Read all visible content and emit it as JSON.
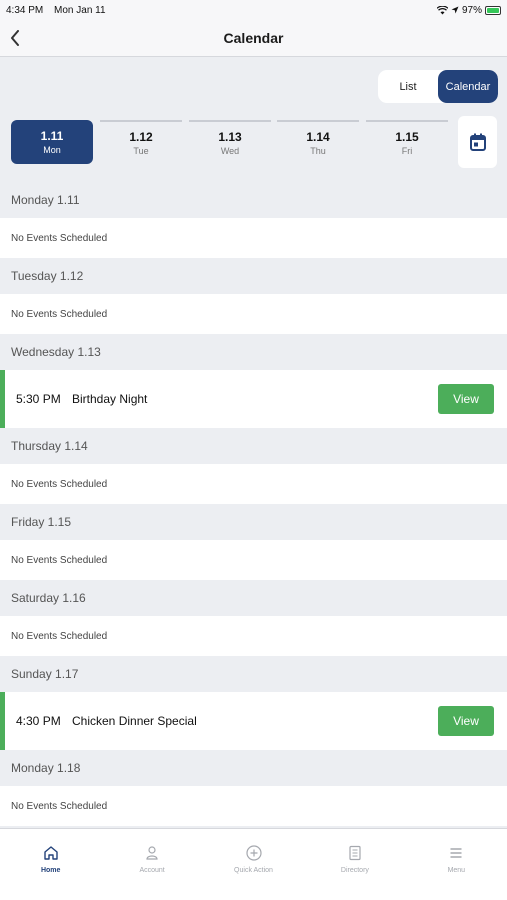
{
  "status_bar": {
    "time": "4:34 PM",
    "date": "Mon Jan 11",
    "battery": "97%"
  },
  "nav": {
    "title": "Calendar"
  },
  "view_toggle": {
    "list_label": "List",
    "calendar_label": "Calendar",
    "selected": "Calendar"
  },
  "day_tabs": [
    {
      "num": "1.11",
      "dow": "Mon",
      "active": true
    },
    {
      "num": "1.12",
      "dow": "Tue",
      "active": false
    },
    {
      "num": "1.13",
      "dow": "Wed",
      "active": false
    },
    {
      "num": "1.14",
      "dow": "Thu",
      "active": false
    },
    {
      "num": "1.15",
      "dow": "Fri",
      "active": false
    }
  ],
  "days": [
    {
      "header": "Monday 1.11",
      "no_events": "No Events Scheduled"
    },
    {
      "header": "Tuesday 1.12",
      "no_events": "No Events Scheduled"
    },
    {
      "header": "Wednesday 1.13",
      "event": {
        "time": "5:30 PM",
        "name": "Birthday Night",
        "button": "View"
      }
    },
    {
      "header": "Thursday 1.14",
      "no_events": "No Events Scheduled"
    },
    {
      "header": "Friday 1.15",
      "no_events": "No Events Scheduled"
    },
    {
      "header": "Saturday 1.16",
      "no_events": "No Events Scheduled"
    },
    {
      "header": "Sunday 1.17",
      "event": {
        "time": "4:30 PM",
        "name": "Chicken Dinner Special",
        "button": "View"
      }
    },
    {
      "header": "Monday 1.18",
      "no_events": "No Events Scheduled"
    }
  ],
  "tab_bar": [
    {
      "label": "Home",
      "icon": "home-icon",
      "active": true
    },
    {
      "label": "Account",
      "icon": "account-icon",
      "active": false
    },
    {
      "label": "Quick Action",
      "icon": "plus-circle-icon",
      "active": false
    },
    {
      "label": "Directory",
      "icon": "directory-icon",
      "active": false
    },
    {
      "label": "Menu",
      "icon": "menu-icon",
      "active": false
    }
  ],
  "colors": {
    "primary": "#23427a",
    "event_accent": "#4cae5a",
    "background": "#eceef2"
  }
}
